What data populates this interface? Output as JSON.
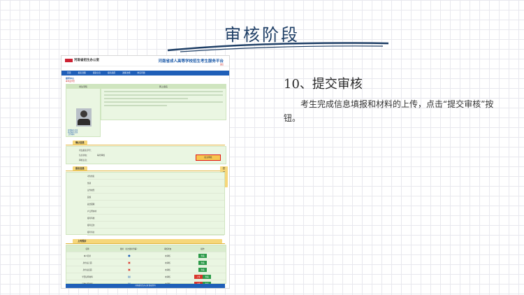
{
  "slide": {
    "title": "审核阶段",
    "step_title": "10、提交审核",
    "step_description": "考生完成信息填报和材料的上传，点击“提交审核”按钮。"
  },
  "screenshot": {
    "office_name": "河南省招生办公室",
    "portal_title": "河南省成人高等学校招生考生服务平台",
    "user_line": "退出",
    "nav": [
      "首页",
      "报名流程",
      "报名信息",
      "报名指南",
      "政策法规",
      "常见问题"
    ],
    "progress_label": "报考中心",
    "progress_sub": "本年度学历",
    "steps_header": "考生须知",
    "notes_header": "网上报名",
    "sidebar_links": [
      "查看报名信息",
      "修改报名信息",
      "上传材料",
      "确认打印"
    ],
    "section_confirm": "确认信息",
    "confirm_rows": [
      "考生报名序号：",
      "信息状态：",
      "审核信息："
    ],
    "confirm_status": "等待审核",
    "submit_button": "提交审核",
    "section_basic": "报名信息",
    "action_buttons": [
      "修改报名",
      "打印报名表",
      "打印"
    ],
    "basic_rows": [
      "考生姓名",
      "性别",
      "证件类型",
      "民族",
      "政治面貌",
      "户口所在地",
      "报考科类",
      "报考层次",
      "报考专业",
      "考试语种",
      "通讯地址",
      "邮政编码",
      "联系电话"
    ],
    "section_materials": "证明材料信息",
    "materials_button": "上传照片",
    "materials_cols": [
      "名称",
      "图片（点击图片查看）",
      "审核状态",
      "操作"
    ],
    "materials_rows": [
      "本人照片",
      "身份证正面",
      "身份证反面",
      "学历证明材料",
      "其他证明材料"
    ],
    "materials_status": "未审核",
    "op_view": "查看",
    "op_upload": "上传",
    "footer": "河南省招生办公室 版权所有"
  },
  "colors": {
    "title": "#1f3f66",
    "nav": "#1f5fb8",
    "highlight": "#e01919",
    "accent_yellow": "#f6c64f"
  }
}
